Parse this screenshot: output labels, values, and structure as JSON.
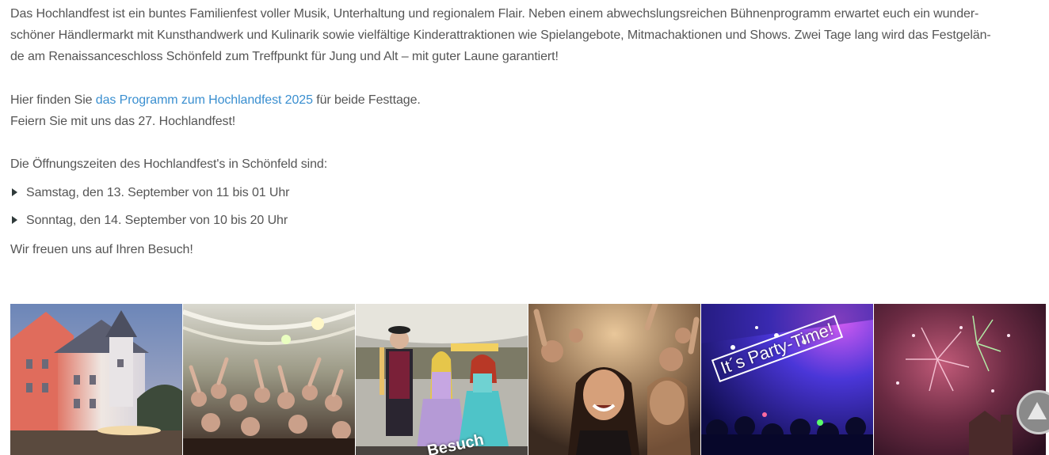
{
  "intro": {
    "text_line1": "Das Hochlandfest ist ein buntes Familienfest voller Musik, Unterhaltung und regionalem Flair. Neben einem abwechslungsreichen Bühnenprogramm erwartet euch ein wunder-",
    "text_line2": "schöner Händlermarkt mit Kunsthandwerk und Kulinarik sowie vielfältige Kinderattraktionen wie Spielangebote, Mitmachaktionen und Shows. Zwei Tage lang wird das Festgelän-",
    "text_line3": "de am Renaissanceschloss Schönfeld zum Treffpunkt für Jung und Alt – mit guter Laune garantiert!"
  },
  "program": {
    "prefix": "Hier finden Sie ",
    "link_label": "das Programm zum Hochlandfest 2025",
    "suffix": " für beide Festtage.",
    "celebrate": "Feiern Sie mit uns das 27. Hochlandfest!"
  },
  "hours": {
    "heading": "Die Öffnungszeiten des Hochlandfest's in Schönfeld sind:",
    "items": [
      "Samstag, den 13. September von 11 bis 01 Uhr",
      "Sonntag, den 14. September von 10 bis 20 Uhr"
    ]
  },
  "closing": "Wir freuen uns auf Ihren Besuch!",
  "gallery": {
    "party_caption": "It´s Party-Time!",
    "besuch_caption": "Besuch"
  },
  "colors": {
    "text": "#555555",
    "link": "#3a8fd0"
  }
}
